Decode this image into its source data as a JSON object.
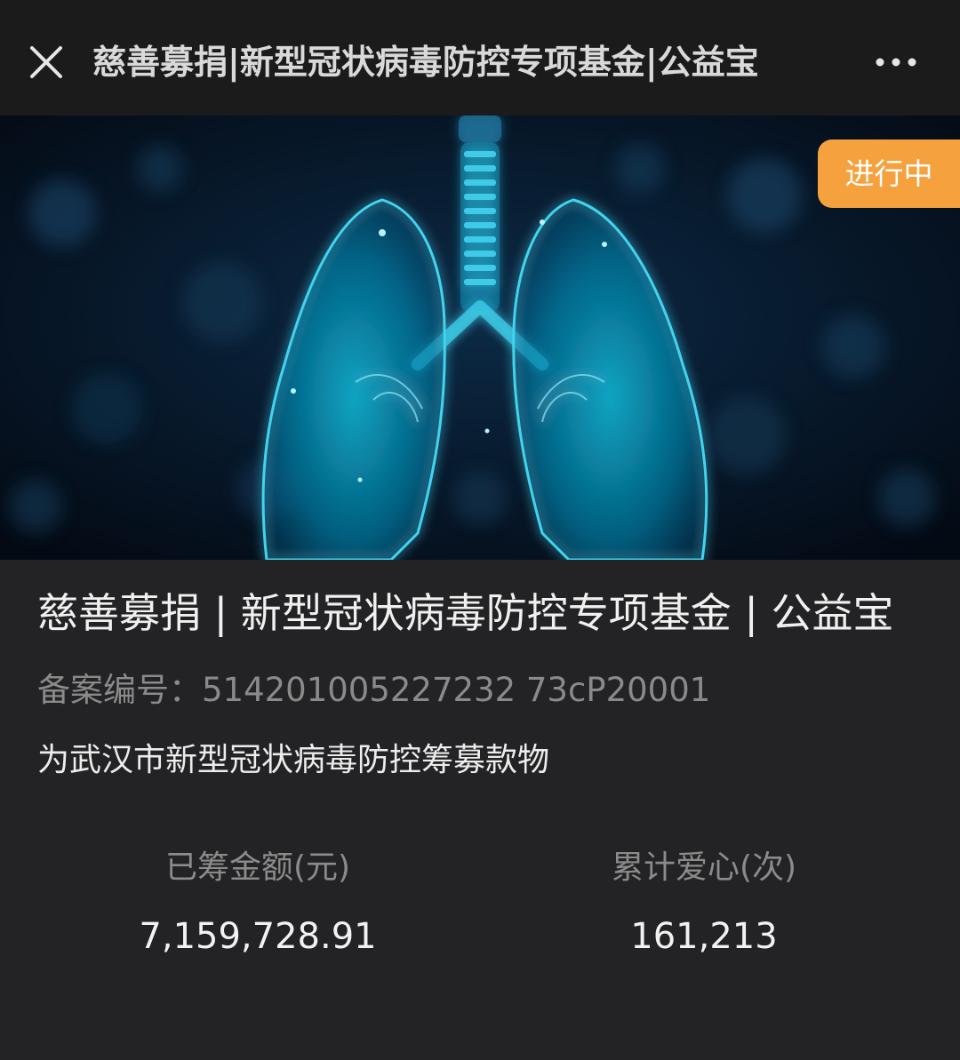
{
  "navbar": {
    "title": "慈善募捐|新型冠状病毒防控专项基金|公益宝",
    "close_icon": "close-icon",
    "more_icon": "more-icon"
  },
  "hero": {
    "image": "lungs-illustration",
    "status_badge": "进行中",
    "badge_color": "#f5a13e"
  },
  "project": {
    "title": "慈善募捐 | 新型冠状病毒防控专项基金 | 公益宝",
    "record_label": "备案编号：",
    "record_number": "514201005227232 73cP20001",
    "description": "为武汉市新型冠状病毒防控筹募款物"
  },
  "stats": [
    {
      "label": "已筹金额(元)",
      "value": "7,159,728.91"
    },
    {
      "label": "累计爱心(次)",
      "value": "161,213"
    }
  ]
}
